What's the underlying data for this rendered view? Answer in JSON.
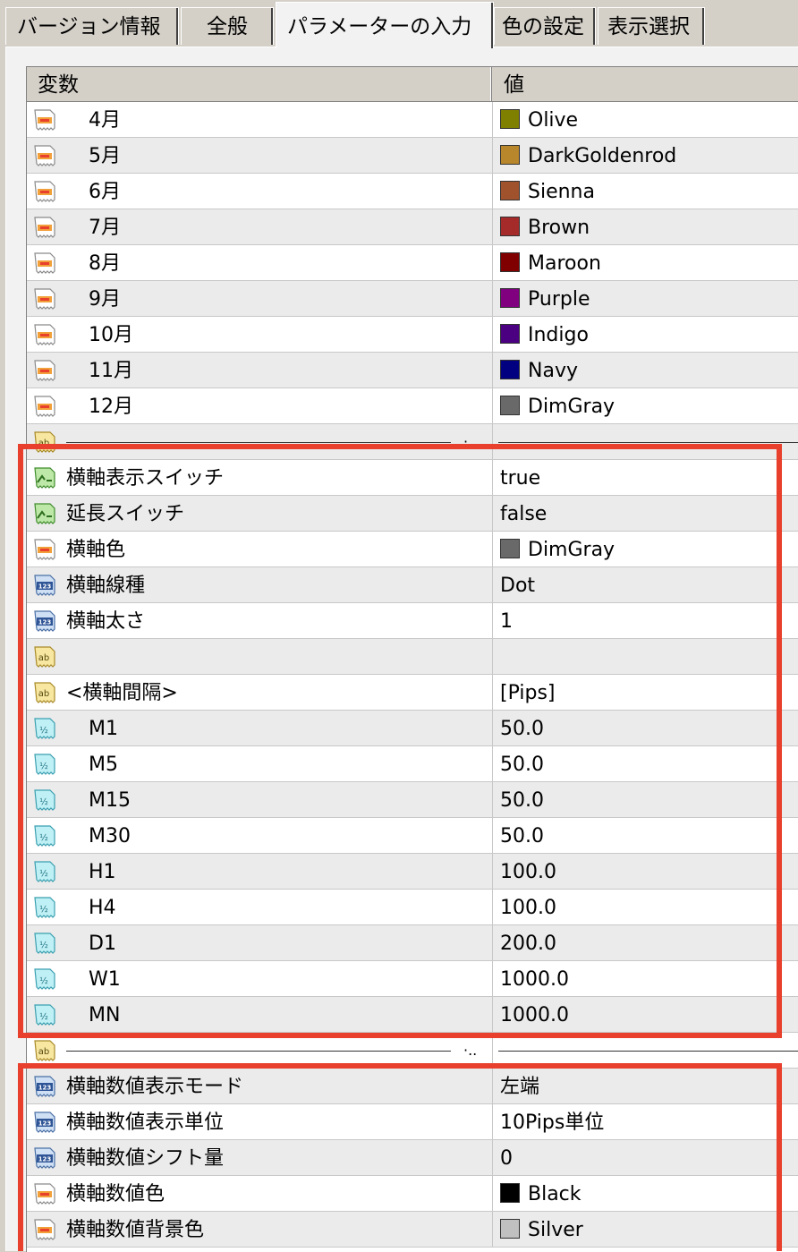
{
  "tabs": [
    {
      "label": "バージョン情報"
    },
    {
      "label": "全般"
    },
    {
      "label": "パラメーターの入力",
      "active": true
    },
    {
      "label": "色の設定"
    },
    {
      "label": "表示選択"
    }
  ],
  "grid": {
    "col_variable": "変数",
    "col_value": "値"
  },
  "rows": [
    {
      "type": "color",
      "name": "4月",
      "indent": true,
      "value": "Olive",
      "color": "#808000"
    },
    {
      "type": "color",
      "name": "5月",
      "indent": true,
      "value": "DarkGoldenrod",
      "color": "#b8862b"
    },
    {
      "type": "color",
      "name": "6月",
      "indent": true,
      "value": "Sienna",
      "color": "#a0522d"
    },
    {
      "type": "color",
      "name": "7月",
      "indent": true,
      "value": "Brown",
      "color": "#a52a2a"
    },
    {
      "type": "color",
      "name": "8月",
      "indent": true,
      "value": "Maroon",
      "color": "#800000"
    },
    {
      "type": "color",
      "name": "9月",
      "indent": true,
      "value": "Purple",
      "color": "#800080"
    },
    {
      "type": "color",
      "name": "10月",
      "indent": true,
      "value": "Indigo",
      "color": "#4b0082"
    },
    {
      "type": "color",
      "name": "11月",
      "indent": true,
      "value": "Navy",
      "color": "#000080"
    },
    {
      "type": "color",
      "name": "12月",
      "indent": true,
      "value": "DimGray",
      "color": "#696969"
    },
    {
      "type": "separator"
    },
    {
      "type": "bool",
      "name": "横軸表示スイッチ",
      "value": "true"
    },
    {
      "type": "bool",
      "name": "延長スイッチ",
      "value": "false"
    },
    {
      "type": "color",
      "name": "横軸色",
      "value": "DimGray",
      "color": "#696969"
    },
    {
      "type": "int",
      "name": "横軸線種",
      "value": "Dot"
    },
    {
      "type": "int",
      "name": "横軸太さ",
      "value": "1"
    },
    {
      "type": "string",
      "name": "",
      "value": ""
    },
    {
      "type": "string",
      "name": "<横軸間隔>",
      "value": "[Pips]"
    },
    {
      "type": "double",
      "name": "M1",
      "indent": true,
      "value": "50.0"
    },
    {
      "type": "double",
      "name": "M5",
      "indent": true,
      "value": "50.0"
    },
    {
      "type": "double",
      "name": "M15",
      "indent": true,
      "value": "50.0"
    },
    {
      "type": "double",
      "name": "M30",
      "indent": true,
      "value": "50.0"
    },
    {
      "type": "double",
      "name": "H1",
      "indent": true,
      "value": "100.0"
    },
    {
      "type": "double",
      "name": "H4",
      "indent": true,
      "value": "100.0"
    },
    {
      "type": "double",
      "name": "D1",
      "indent": true,
      "value": "200.0"
    },
    {
      "type": "double",
      "name": "W1",
      "indent": true,
      "value": "1000.0"
    },
    {
      "type": "double",
      "name": "MN",
      "indent": true,
      "value": "1000.0"
    },
    {
      "type": "separator"
    },
    {
      "type": "int",
      "name": "横軸数値表示モード",
      "value": "左端"
    },
    {
      "type": "int",
      "name": "横軸数値表示単位",
      "value": "10Pips単位"
    },
    {
      "type": "int",
      "name": "横軸数値シフト量",
      "value": "0"
    },
    {
      "type": "color",
      "name": "横軸数値色",
      "value": "Black",
      "color": "#000000"
    },
    {
      "type": "color",
      "name": "横軸数値背景色",
      "value": "Silver",
      "color": "#c0c0c0"
    }
  ],
  "colors": {
    "highlight": "#e8402d"
  }
}
